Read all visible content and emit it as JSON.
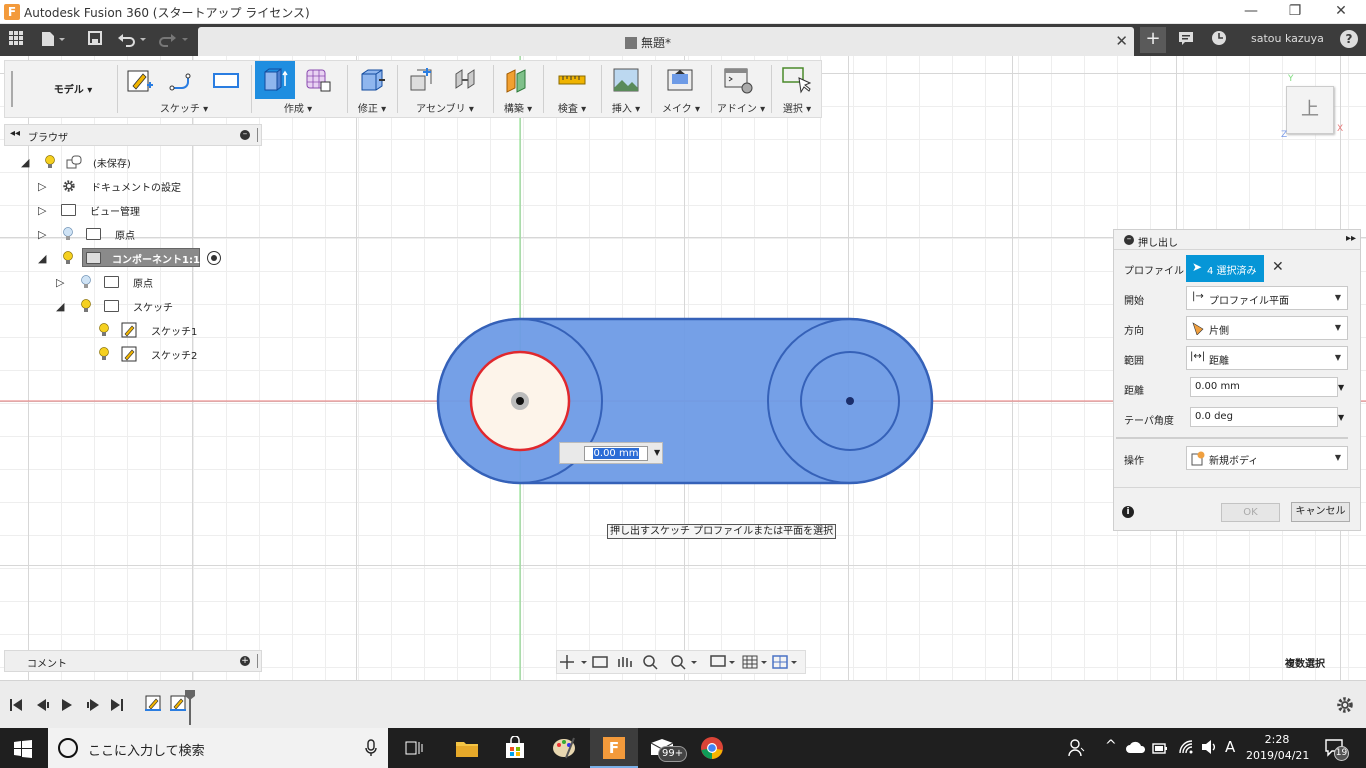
{
  "window": {
    "title": "Autodesk Fusion 360 (スタートアップ ライセンス)",
    "logo_letter": "F",
    "minimize": "—",
    "restore": "❐",
    "close": "✕"
  },
  "tabbar": {
    "doc_title": "無題*",
    "close": "✕",
    "new_tab": "+",
    "user": "satou kazuya",
    "help": "?"
  },
  "toolbar": {
    "workspace": "モデル ▾",
    "groups": [
      {
        "label": "スケッチ ▾"
      },
      {
        "label": "作成 ▾"
      },
      {
        "label": "修正 ▾"
      },
      {
        "label": "アセンブリ ▾"
      },
      {
        "label": "構築 ▾"
      },
      {
        "label": "検査 ▾"
      },
      {
        "label": "挿入 ▾"
      },
      {
        "label": "メイク ▾"
      },
      {
        "label": "アドイン ▾"
      },
      {
        "label": "選択 ▾"
      }
    ]
  },
  "browser": {
    "title": "ブラウザ",
    "items": [
      {
        "label": "(未保存)"
      },
      {
        "label": "ドキュメントの設定"
      },
      {
        "label": "ビュー管理"
      },
      {
        "label": "原点"
      },
      {
        "label": "コンポーネント1:1"
      },
      {
        "label": "原点"
      },
      {
        "label": "スケッチ"
      },
      {
        "label": "スケッチ1"
      },
      {
        "label": "スケッチ2"
      }
    ]
  },
  "comment_panel": {
    "title": "コメント"
  },
  "viewcube": {
    "face": "上",
    "axis_x": "X",
    "axis_y": "Y",
    "axis_z": "Z"
  },
  "viewport": {
    "distance_input": "0.00 mm",
    "hint": "押し出すスケッチ プロファイルまたは平面を選択",
    "multi_select": "複数選択"
  },
  "extrude_panel": {
    "title": "押し出し",
    "profile_label": "プロファイル",
    "profile_value": "4 選択済み",
    "start_label": "開始",
    "start_value": "プロファイル平面",
    "direction_label": "方向",
    "direction_value": "片側",
    "extent_label": "範囲",
    "extent_value": "距離",
    "distance_label": "距離",
    "distance_value": "0.00 mm",
    "taper_label": "テーパ角度",
    "taper_value": "0.0 deg",
    "operation_label": "操作",
    "operation_value": "新規ボディ",
    "ok": "OK",
    "cancel": "キャンセル"
  },
  "taskbar": {
    "search_placeholder": "ここに入力して検索",
    "time": "2:28",
    "date": "2019/04/21",
    "ime": "A",
    "notification_count": "19",
    "mail_badge": "99+"
  },
  "colors": {
    "accent": "#0696d7",
    "body_fill": "#6e9be6",
    "body_stroke": "#3561b8",
    "selected_circle": "#e0282e",
    "x_axis": "#e87a7a",
    "y_axis": "#7fdc7f"
  }
}
